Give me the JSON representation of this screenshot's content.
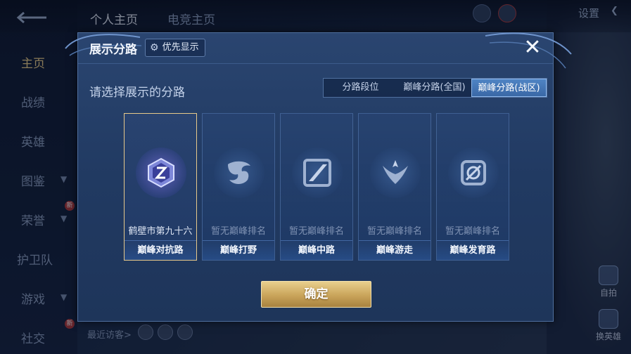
{
  "background": {
    "top_tabs": [
      "个人主页",
      "电竞主页"
    ],
    "settings_label": "设置",
    "side_nav": [
      {
        "label": "主页",
        "active": true
      },
      {
        "label": "战绩",
        "active": false
      },
      {
        "label": "英雄",
        "active": false
      },
      {
        "label": "图鉴",
        "active": false
      },
      {
        "label": "荣誉",
        "active": false
      },
      {
        "label": "护卫队",
        "active": false
      },
      {
        "label": "游戏",
        "active": false
      },
      {
        "label": "社交",
        "active": false
      }
    ],
    "side_badge": "新",
    "recent_visitors_label": "最近访客>",
    "right_buttons": [
      "自拍",
      "换英雄"
    ]
  },
  "modal": {
    "title": "展示分路",
    "priority_button": "优先显示",
    "close_icon": "close-icon",
    "subtitle": "请选择展示的分路",
    "tabs": [
      {
        "label": "分路段位",
        "active": false
      },
      {
        "label": "巅峰分路(全国)",
        "active": false
      },
      {
        "label": "巅峰分路(战区)",
        "active": true
      }
    ],
    "cards": [
      {
        "rank": "鹤壁市第九十六",
        "lane": "巅峰对抗路",
        "selected": true,
        "icon": "clash-lane-icon"
      },
      {
        "rank": "暂无巅峰排名",
        "lane": "巅峰打野",
        "selected": false,
        "icon": "jungle-icon"
      },
      {
        "rank": "暂无巅峰排名",
        "lane": "巅峰中路",
        "selected": false,
        "icon": "mid-lane-icon"
      },
      {
        "rank": "暂无巅峰排名",
        "lane": "巅峰游走",
        "selected": false,
        "icon": "roam-icon"
      },
      {
        "rank": "暂无巅峰排名",
        "lane": "巅峰发育路",
        "selected": false,
        "icon": "farm-lane-icon"
      }
    ],
    "confirm_button": "确定"
  },
  "colors": {
    "accent_gold": "#e7c98a",
    "active_tab": "#4f84c4",
    "panel_bg": "#213a62"
  }
}
